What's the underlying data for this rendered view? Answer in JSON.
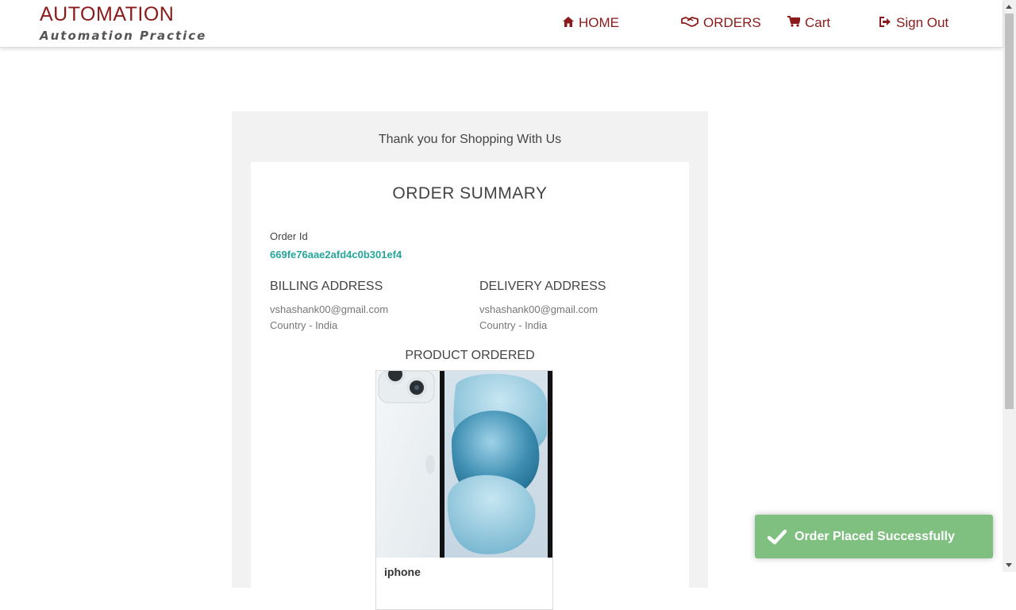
{
  "brand": {
    "title": "AUTOMATION",
    "subtitle": "Automation Practice"
  },
  "nav": {
    "home": "HOME",
    "orders": "ORDERS",
    "cart": "Cart",
    "sign_out": "Sign Out"
  },
  "main": {
    "thanks": "Thank you for Shopping With Us",
    "summary_title": "ORDER SUMMARY",
    "order_id_label": "Order Id",
    "order_id": "669fe76aae2afd4c0b301ef4",
    "billing": {
      "title": "BILLING ADDRESS",
      "email": "vshashank00@gmail.com",
      "country": "Country - India"
    },
    "delivery": {
      "title": "DELIVERY ADDRESS",
      "email": "vshashank00@gmail.com",
      "country": "Country - India"
    },
    "product_title": "PRODUCT ORDERED",
    "product_name": "iphone"
  },
  "toast": {
    "message": "Order Placed Successfully"
  },
  "colors": {
    "brand": "#8b1a1a",
    "order_id": "#26a69a",
    "toast_bg": "#7fbf7f"
  },
  "icons": {
    "home": "home-icon",
    "orders": "handshake-icon",
    "cart": "cart-icon",
    "sign_out": "sign-out-icon",
    "toast": "check-icon"
  }
}
